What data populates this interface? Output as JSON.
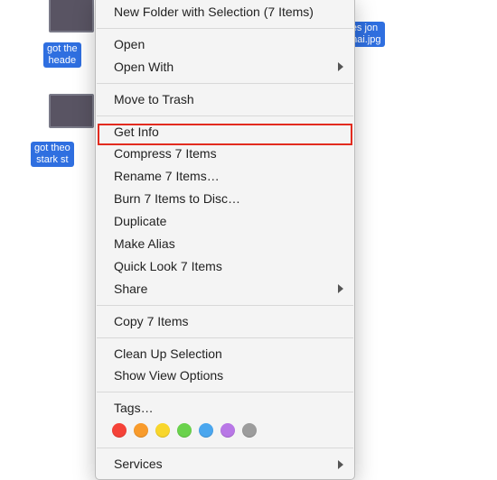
{
  "desktop": {
    "leftFile1Label": "got the\nheade",
    "leftFile2Label": "got theo\nstark st",
    "rightFileLabel": "ies jon\nahai.jpg"
  },
  "menu": {
    "newFolder": "New Folder with Selection (7 Items)",
    "open": "Open",
    "openWith": "Open With",
    "moveToTrash": "Move to Trash",
    "getInfo": "Get Info",
    "compress": "Compress 7 Items",
    "rename": "Rename 7 Items…",
    "burn": "Burn 7 Items to Disc…",
    "duplicate": "Duplicate",
    "makeAlias": "Make Alias",
    "quickLook": "Quick Look 7 Items",
    "share": "Share",
    "copy": "Copy 7 Items",
    "cleanUp": "Clean Up Selection",
    "showView": "Show View Options",
    "tags": "Tags…",
    "services": "Services"
  },
  "tagColors": [
    "#f54238",
    "#f89b2c",
    "#f8d62c",
    "#6ad24c",
    "#4aa6ee",
    "#b877e6",
    "#9c9c9c"
  ]
}
